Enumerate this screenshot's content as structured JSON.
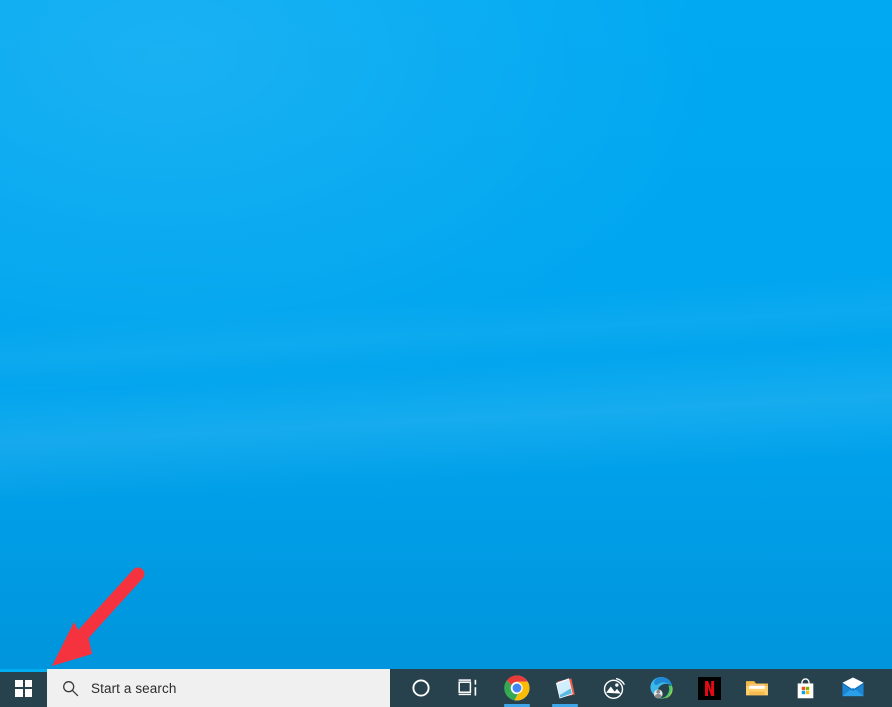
{
  "desktop": {
    "name": "windows-desktop",
    "wallpaper_color": "#00a8f0",
    "wallpaper_color_bottom": "#009fe8"
  },
  "annotation": {
    "arrow_name": "red-pointer-arrow",
    "color": "#f5333f",
    "points_to": "start-button",
    "direction": "down-left"
  },
  "taskbar": {
    "background_color": "#27424c",
    "accent_color": "#00adef",
    "running_indicator_color": "#3ea6e8",
    "start": {
      "label": "Start",
      "icon": "windows-logo-icon"
    },
    "search": {
      "placeholder": "Start a search",
      "value": "",
      "icon": "search-icon",
      "background_color": "#f0f0f0",
      "text_color": "#2b2b2b"
    },
    "items": [
      {
        "label": "Cortana",
        "icon": "cortana-circle-icon",
        "running": false
      },
      {
        "label": "Task View",
        "icon": "task-view-icon",
        "running": false
      },
      {
        "label": "Google Chrome",
        "icon": "chrome-icon",
        "running": true
      },
      {
        "label": "Sticky Notes",
        "icon": "sticky-notes-icon",
        "running": true
      },
      {
        "label": "Photos",
        "icon": "photos-icon",
        "running": false
      },
      {
        "label": "Microsoft Edge",
        "icon": "edge-icon",
        "running": false
      },
      {
        "label": "Netflix",
        "icon": "netflix-icon",
        "running": false
      },
      {
        "label": "File Explorer",
        "icon": "file-explorer-icon",
        "running": false
      },
      {
        "label": "Microsoft Store",
        "icon": "microsoft-store-icon",
        "running": false
      },
      {
        "label": "Mail",
        "icon": "mail-icon",
        "running": false
      }
    ]
  }
}
